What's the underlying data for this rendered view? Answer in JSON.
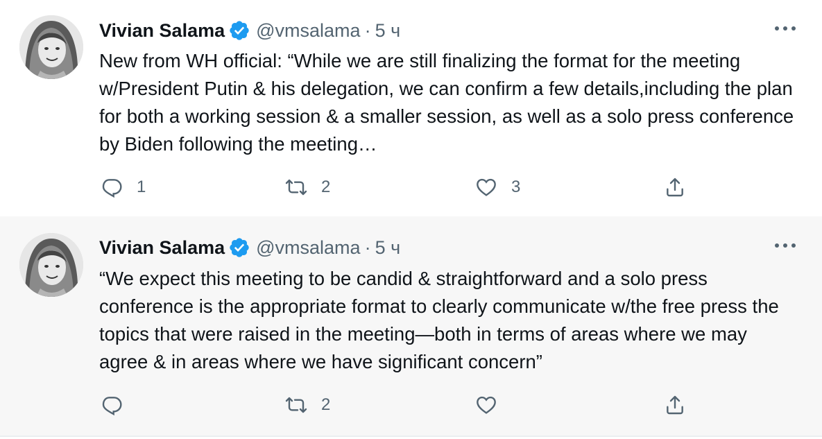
{
  "colors": {
    "verified": "#1d9bf0",
    "secondary_text": "#536471",
    "thread_line": "#c4cfd6",
    "highlight_bg": "#f7f7f7"
  },
  "tweets": [
    {
      "author_name": "Vivian Salama",
      "handle": "@vmsalama",
      "separator": "·",
      "time": "5 ч",
      "text": "New from WH official: “While we are still finalizing the format for the meeting w/President Putin & his delegation, we can confirm a few details,including the plan for both a working session & a smaller session, as well as a solo press conference by Biden following the meeting…",
      "reply_count": "1",
      "retweet_count": "2",
      "like_count": "3",
      "icons": [
        "verified-badge-icon",
        "more-options-icon",
        "reply-icon",
        "retweet-icon",
        "like-icon",
        "share-icon"
      ]
    },
    {
      "author_name": "Vivian Salama",
      "handle": "@vmsalama",
      "separator": "·",
      "time": "5 ч",
      "text": "“We expect this meeting to be candid & straightforward and a solo press conference is the appropriate format to clearly communicate w/the free press the topics that were raised in the meeting—both in terms of areas where we may agree & in areas where we have significant concern”",
      "reply_count": "",
      "retweet_count": "2",
      "like_count": "",
      "icons": [
        "verified-badge-icon",
        "more-options-icon",
        "reply-icon",
        "retweet-icon",
        "like-icon",
        "share-icon"
      ]
    }
  ]
}
